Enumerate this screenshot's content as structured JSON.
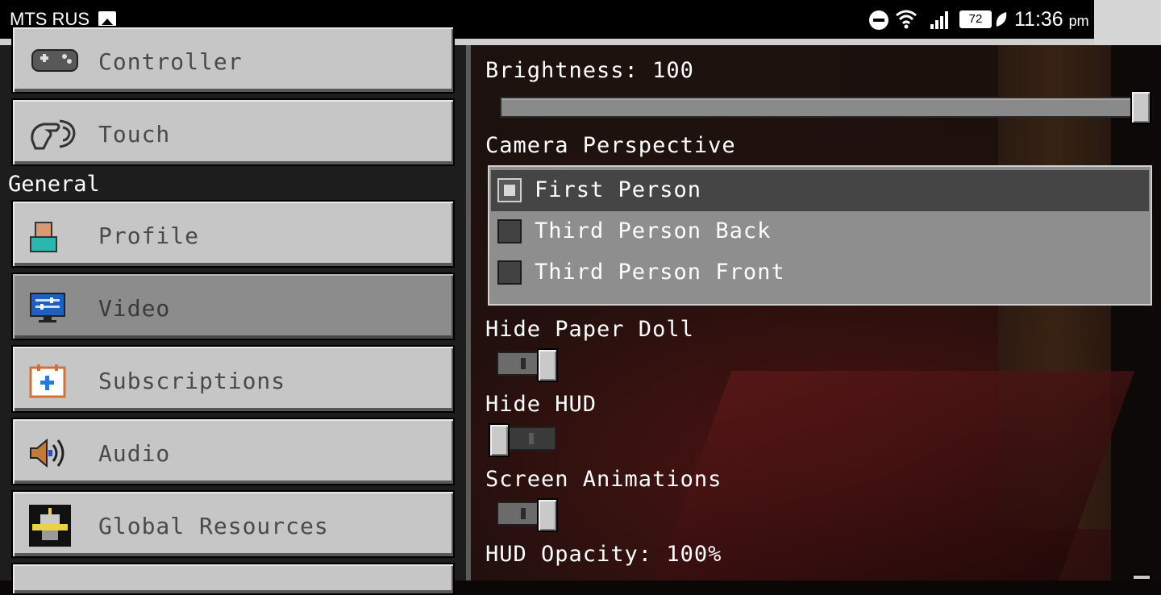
{
  "status_bar": {
    "carrier": "MTS RUS",
    "battery_level": "72",
    "time": "11:36",
    "time_suffix": "pm"
  },
  "sidebar": {
    "section_general": "General",
    "items": [
      {
        "label": "Controller",
        "icon": "gamepad-icon"
      },
      {
        "label": "Touch",
        "icon": "touch-hand-icon"
      },
      {
        "label": "Profile",
        "icon": "profile-icon"
      },
      {
        "label": "Video",
        "icon": "monitor-icon",
        "selected": true
      },
      {
        "label": "Subscriptions",
        "icon": "subscriptions-icon"
      },
      {
        "label": "Audio",
        "icon": "speaker-icon"
      },
      {
        "label": "Global Resources",
        "icon": "resource-pack-icon"
      }
    ]
  },
  "settings": {
    "brightness_label": "Brightness: 100",
    "brightness_value": 100,
    "camera_perspective_label": "Camera Perspective",
    "camera_options": [
      {
        "label": "First Person",
        "selected": true
      },
      {
        "label": "Third Person Back",
        "selected": false
      },
      {
        "label": "Third Person Front",
        "selected": false
      }
    ],
    "hide_paper_doll_label": "Hide Paper Doll",
    "hide_paper_doll": true,
    "hide_hud_label": "Hide HUD",
    "hide_hud": false,
    "screen_animations_label": "Screen Animations",
    "screen_animations": true,
    "hud_opacity_label": "HUD Opacity: 100%"
  },
  "colors": {
    "button_face": "#c6c6c6",
    "button_selected": "#8c8c8c",
    "panel_bg": "#1d1d1d"
  }
}
